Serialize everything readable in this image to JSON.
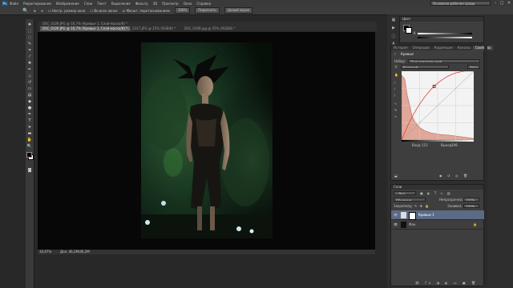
{
  "app": {
    "logo": "Ps",
    "menus": [
      "Файл",
      "Редактирование",
      "Изображение",
      "Слои",
      "Текст",
      "Выделение",
      "Фильтр",
      "3D",
      "Просмотр",
      "Окно",
      "Справка"
    ],
    "workspace": "Основная рабочая среда",
    "window_controls": [
      "–",
      "□",
      "✕"
    ]
  },
  "options_bar": {
    "items": [
      "Настр. размер окна",
      "Во всех окнах",
      "Масшт. перетаскиванием"
    ],
    "buttons": [
      "100%",
      "Подогнать",
      "Целый экран"
    ]
  },
  "document": {
    "tabs": [
      {
        "label": "DSC_0328.JPG @ 16,7% (Кривые 1, Слой-маска/8) *",
        "active": false
      },
      {
        "label": "DSC_0326.JPG @ 16,7% (Кривые 1, Слой-маска/8) *",
        "active": true
      },
      {
        "label": "DSC_0317.JPG @ 25% (RGB/8) *",
        "active": false
      },
      {
        "label": "DSC_0308.jpg @ 25% (RGB/8) *",
        "active": false
      }
    ],
    "zoom": "16,67%",
    "doc_info": "Док: 46,2M/46,2M"
  },
  "color_panel": {
    "tab": "Цвет",
    "value_label": "K"
  },
  "properties_panel": {
    "tabs": [
      "История",
      "Операции",
      "Коррекция",
      "Каналы",
      "Свойства"
    ],
    "active_tab": "Свойства",
    "title": "Кривые",
    "preset_label": "Набор:",
    "preset_value": "Пользовательский",
    "channel_value": "Красный",
    "auto_button": "Авто",
    "input_label": "Вход:",
    "input_value": "115",
    "output_label": "Выход:",
    "output_value": "199"
  },
  "layers_panel": {
    "tab": "Слои",
    "filter_kind": "Вид",
    "blend_mode": "Обычные",
    "opacity_label": "Непрозрачность:",
    "opacity_value": "100%",
    "lock_label": "Закрепить:",
    "fill_label": "Заливка:",
    "fill_value": "100%",
    "layers": [
      {
        "name": "Кривые 1",
        "selected": true
      },
      {
        "name": "Фон",
        "selected": false
      }
    ]
  },
  "curve": {
    "input": 115,
    "output": 199
  }
}
